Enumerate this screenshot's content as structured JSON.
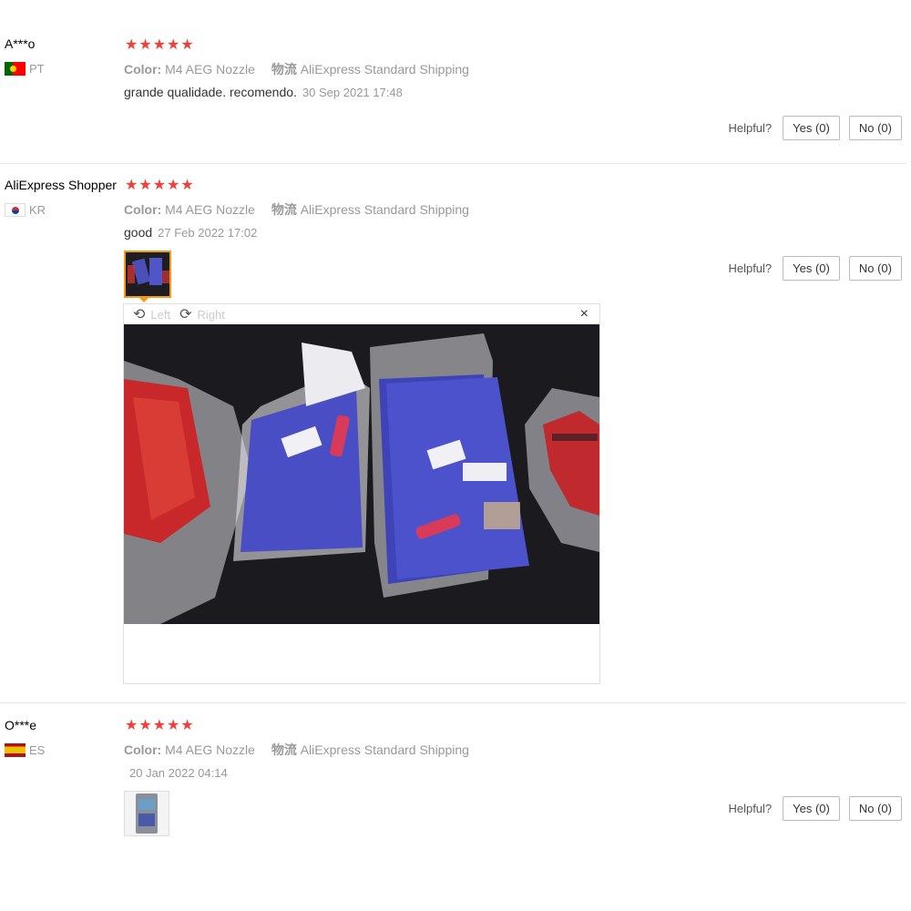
{
  "colors": {
    "star": "#f0403a",
    "muted": "#999999",
    "divider": "#e5e5e5"
  },
  "labels": {
    "color_label": "Color:",
    "shipping_label": "物流",
    "helpful": "Helpful?",
    "yes": "Yes (0)",
    "no": "No (0)"
  },
  "reviews": [
    {
      "name": "A***o",
      "country": "PT",
      "rating": 5,
      "color": "M4 AEG Nozzle",
      "shipping": "AliExpress Standard Shipping",
      "text": "grande qualidade. recomendo.",
      "date": "30 Sep 2021 17:48"
    },
    {
      "name": "AliExpress Shopper",
      "country": "KR",
      "rating": 5,
      "color": "M4 AEG Nozzle",
      "shipping": "AliExpress Standard Shipping",
      "text": "good",
      "date": "27 Feb 2022 17:02",
      "viewer": {
        "rotate_left": "Left",
        "rotate_right": "Right",
        "close": "×"
      }
    },
    {
      "name": "O***e",
      "country": "ES",
      "rating": 5,
      "color": "M4 AEG Nozzle",
      "shipping": "AliExpress Standard Shipping",
      "text": "",
      "date": "20 Jan 2022 04:14"
    }
  ]
}
